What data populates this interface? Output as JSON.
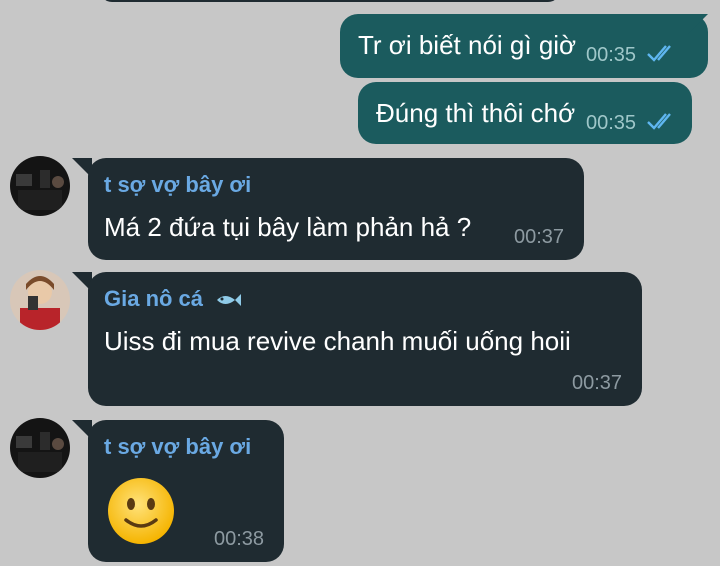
{
  "outgoing": [
    {
      "text": "Tr ơi biết nói gì giờ",
      "time": "00:35"
    },
    {
      "text": "Đúng thì thôi chớ",
      "time": "00:35"
    }
  ],
  "incoming": [
    {
      "sender": "t sợ vợ bây ơi",
      "text": "Má 2 đứa tụi bây làm phản hả ?",
      "time": "00:37"
    },
    {
      "sender": "Gia nô cá",
      "sender_icon": "fish-emoji",
      "text": "Uiss đi mua revive chanh muối uống hoii",
      "time": "00:37"
    },
    {
      "sender": "t sợ vợ bây ơi",
      "sticker": "slightly-smiling-face-emoji",
      "time": "00:38"
    }
  ],
  "colors": {
    "background": "#c7c7c7",
    "outgoing_bubble": "#1b5b5e",
    "incoming_bubble": "#1f2b31",
    "sender_name": "#6aa9e3",
    "read_ticks": "#5fb6f0"
  }
}
